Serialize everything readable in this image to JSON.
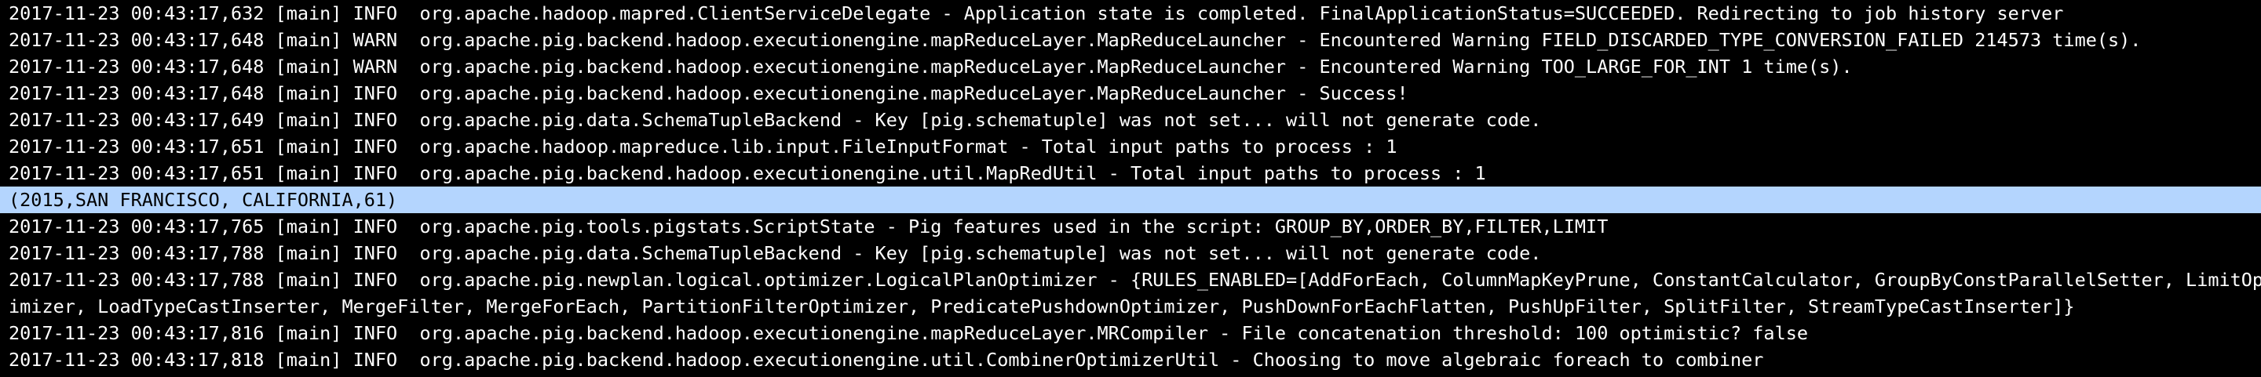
{
  "terminal": {
    "colors": {
      "background": "#000000",
      "foreground": "#ffffff",
      "selection_background": "#b4d5fe",
      "selection_foreground": "#000000"
    },
    "lines": [
      "2017-11-23 00:43:17,632 [main] INFO  org.apache.hadoop.mapred.ClientServiceDelegate - Application state is completed. FinalApplicationStatus=SUCCEEDED. Redirecting to job history server",
      "2017-11-23 00:43:17,648 [main] WARN  org.apache.pig.backend.hadoop.executionengine.mapReduceLayer.MapReduceLauncher - Encountered Warning FIELD_DISCARDED_TYPE_CONVERSION_FAILED 214573 time(s).",
      "2017-11-23 00:43:17,648 [main] WARN  org.apache.pig.backend.hadoop.executionengine.mapReduceLayer.MapReduceLauncher - Encountered Warning TOO_LARGE_FOR_INT 1 time(s).",
      "2017-11-23 00:43:17,648 [main] INFO  org.apache.pig.backend.hadoop.executionengine.mapReduceLayer.MapReduceLauncher - Success!",
      "2017-11-23 00:43:17,649 [main] INFO  org.apache.pig.data.SchemaTupleBackend - Key [pig.schematuple] was not set... will not generate code.",
      "2017-11-23 00:43:17,651 [main] INFO  org.apache.hadoop.mapreduce.lib.input.FileInputFormat - Total input paths to process : 1",
      "2017-11-23 00:43:17,651 [main] INFO  org.apache.pig.backend.hadoop.executionengine.util.MapRedUtil - Total input paths to process : 1",
      "(2015,SAN FRANCISCO, CALIFORNIA,61)",
      "2017-11-23 00:43:17,765 [main] INFO  org.apache.pig.tools.pigstats.ScriptState - Pig features used in the script: GROUP_BY,ORDER_BY,FILTER,LIMIT",
      "2017-11-23 00:43:17,788 [main] INFO  org.apache.pig.data.SchemaTupleBackend - Key [pig.schematuple] was not set... will not generate code.",
      "2017-11-23 00:43:17,788 [main] INFO  org.apache.pig.newplan.logical.optimizer.LogicalPlanOptimizer - {RULES_ENABLED=[AddForEach, ColumnMapKeyPrune, ConstantCalculator, GroupByConstParallelSetter, LimitOpt",
      "imizer, LoadTypeCastInserter, MergeFilter, MergeForEach, PartitionFilterOptimizer, PredicatePushdownOptimizer, PushDownForEachFlatten, PushUpFilter, SplitFilter, StreamTypeCastInserter]}",
      "2017-11-23 00:43:17,816 [main] INFO  org.apache.pig.backend.hadoop.executionengine.mapReduceLayer.MRCompiler - File concatenation threshold: 100 optimistic? false",
      "2017-11-23 00:43:17,818 [main] INFO  org.apache.pig.backend.hadoop.executionengine.util.CombinerOptimizerUtil - Choosing to move algebraic foreach to combiner"
    ]
  }
}
